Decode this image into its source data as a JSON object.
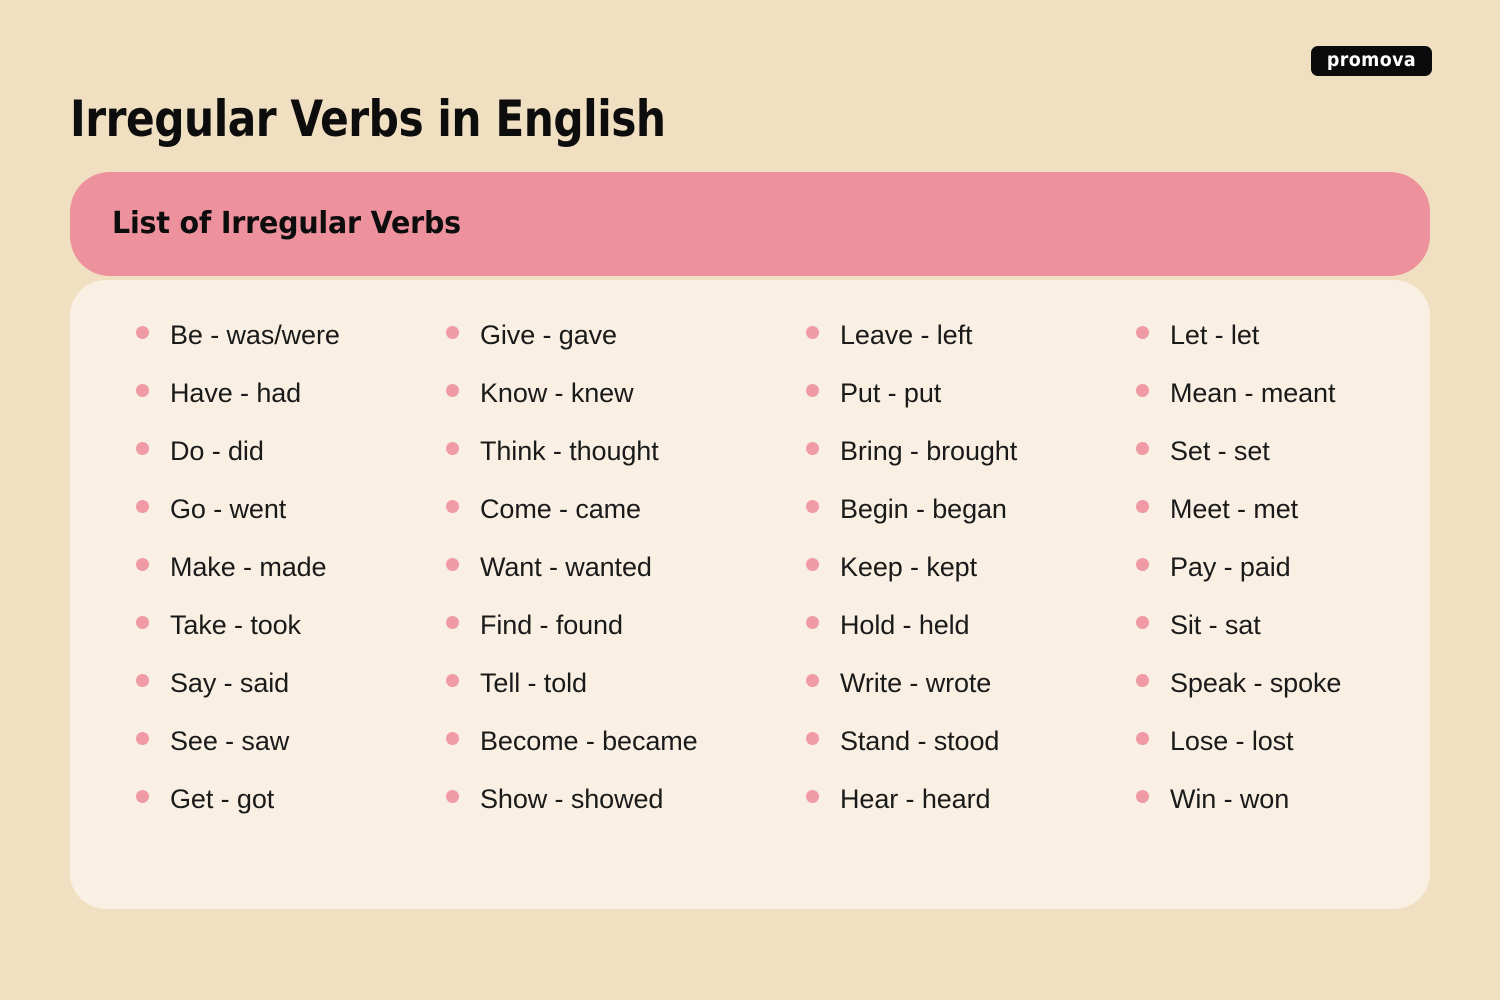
{
  "header": {
    "title": "Irregular Verbs in English",
    "brand": {
      "name": "promova",
      "icon": "promova-wordmark-logo",
      "background_color": "#0b0b0b",
      "text_color": "#ffffff"
    }
  },
  "card": {
    "section_title": "List of Irregular Verbs",
    "header_color": "#ed919d",
    "body_color": "#f9f0e3"
  },
  "theme": {
    "page_background": "#f1dfc1",
    "accent_pink": "#ed919d",
    "bullet_pink": "#ef9aa4",
    "text_color": "#1a1a1a",
    "heading_color": "#0d0d0d"
  },
  "verb_columns": [
    {
      "items": [
        "Be - was/were",
        "Have - had",
        "Do - did",
        "Go - went",
        "Make - made",
        "Take - took",
        "Say - said",
        "See - saw",
        "Get - got"
      ]
    },
    {
      "items": [
        "Give - gave",
        "Know - knew",
        "Think - thought",
        "Come - came",
        "Want - wanted",
        "Find - found",
        "Tell - told",
        "Become - became",
        "Show - showed"
      ]
    },
    {
      "items": [
        "Leave - left",
        "Put - put",
        "Bring - brought",
        "Begin - began",
        "Keep - kept",
        "Hold - held",
        "Write - wrote",
        "Stand - stood",
        "Hear - heard"
      ]
    },
    {
      "items": [
        "Let - let",
        "Mean - meant",
        "Set - set",
        "Meet - met",
        "Pay - paid",
        "Sit - sat",
        "Speak - spoke",
        "Lose - lost",
        "Win - won"
      ]
    }
  ]
}
